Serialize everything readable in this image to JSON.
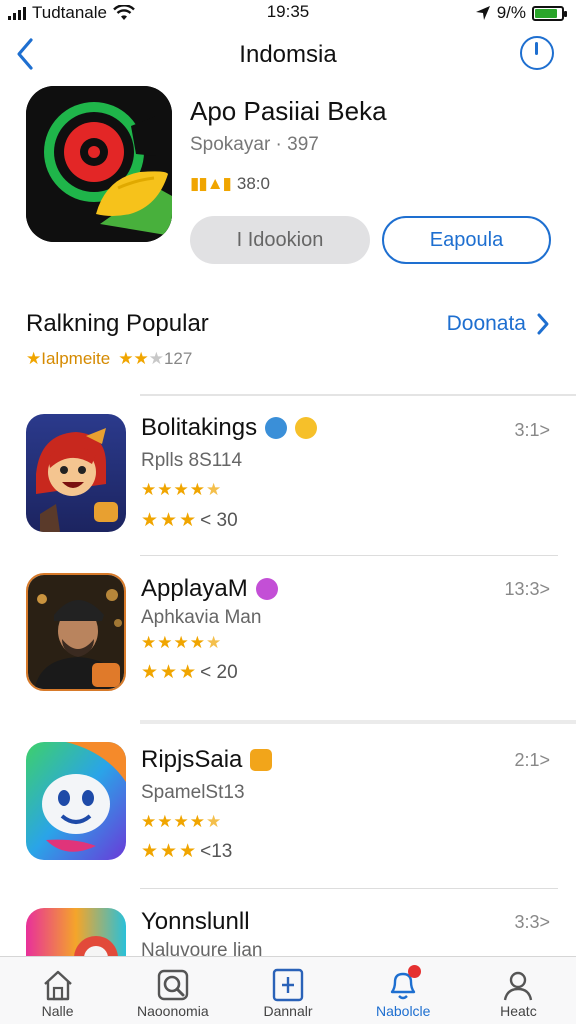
{
  "status": {
    "carrier": "Tudtanale",
    "time": "19:35",
    "battery_text": "9/%",
    "battery_level": 0.85
  },
  "nav": {
    "title": "Indomsia",
    "back_icon": "chevron-left-icon",
    "right_icon": "power-icon"
  },
  "hero": {
    "name": "Apo Pasiiai Beka",
    "subtitle": "Spokayar · 397",
    "rating_text": "38:0",
    "primary_button": "I Idookion",
    "secondary_button": "Eapoula"
  },
  "section": {
    "title": "Ralkning Popular",
    "link": "Doonata",
    "sub_label": "Ialpmeite",
    "sub_count": "127"
  },
  "apps": [
    {
      "name": "Bolitakings",
      "subtitle": "Rplls 8S114",
      "rating": 4.5,
      "secondary_stars": 3,
      "count": "< 30",
      "meta": "3:1>"
    },
    {
      "name": "ApplayaM",
      "subtitle": "Aphkavia Man",
      "rating": 4.5,
      "secondary_stars": 3,
      "count": "< 20",
      "meta": "13:3>"
    },
    {
      "name": "RipjsSaia",
      "subtitle": "SpamelSt13",
      "rating": 4.5,
      "secondary_stars": 3,
      "count": "<13",
      "meta": "2:1>"
    },
    {
      "name": "Yonnslunll",
      "subtitle": "Naluvoure lian",
      "rating": 0,
      "secondary_stars": 0,
      "count": "",
      "meta": "3:3>"
    }
  ],
  "tabs": [
    {
      "label": "Nalle",
      "icon": "home-icon"
    },
    {
      "label": "Naoonomia",
      "icon": "search-icon"
    },
    {
      "label": "Dannalr",
      "icon": "add-box-icon"
    },
    {
      "label": "Nabolcle",
      "icon": "notification-bell-icon"
    },
    {
      "label": "Heatc",
      "icon": "profile-icon"
    }
  ],
  "colors": {
    "accent": "#1e6fd0",
    "star": "#f0a500",
    "badge": "#e53030"
  }
}
